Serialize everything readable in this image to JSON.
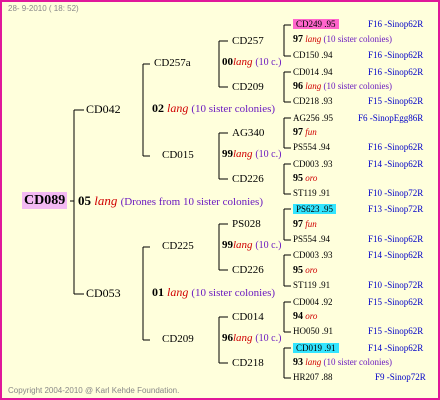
{
  "header": {
    "timestamp": "28- 9-2010 ( 18: 52)"
  },
  "footer": {
    "copyright": "Copyright 2004-2010 @ Karl Kehde Foundation."
  },
  "root": {
    "id": "CD089",
    "gen": "05",
    "lang": "lang",
    "note": "(Drones from 10 sister colonies)"
  },
  "level1": [
    {
      "id": "CD042",
      "gen": "02",
      "lang": "lang",
      "note": "(10 sister colonies)"
    },
    {
      "id": "CD053",
      "gen": "01",
      "lang": "lang",
      "note": "(10 sister colonies)"
    }
  ],
  "level2": [
    {
      "id": "CD257a",
      "gen": "00",
      "lang": "lang",
      "note": "(10 c.)"
    },
    {
      "id": "CD015",
      "gen": "99",
      "lang": "lang",
      "note": "(10 c.)"
    },
    {
      "id": "CD225",
      "gen": "99",
      "lang": "lang",
      "note": "(10 c.)"
    },
    {
      "id": "CD209",
      "gen": "96",
      "lang": "lang",
      "note": "(10 c.)"
    }
  ],
  "level3": [
    {
      "id": "CD257"
    },
    {
      "id": "CD209"
    },
    {
      "id": "AG340"
    },
    {
      "id": "CD226"
    },
    {
      "id": "PS028"
    },
    {
      "id": "CD226"
    },
    {
      "id": "CD014"
    },
    {
      "id": "CD218"
    }
  ],
  "rows": [
    {
      "left": "CD249 .95",
      "right": "F16 -Sinop62R"
    },
    {
      "cnt": "97",
      "lang": "lang",
      "note": "(10 sister colonies)"
    },
    {
      "left": "CD150 .94",
      "right": "F16 -Sinop62R"
    },
    {
      "left": "CD014 .94",
      "right": "F16 -Sinop62R"
    },
    {
      "cnt": "96",
      "lang": "lang",
      "note": "(10 sister colonies)"
    },
    {
      "left": "CD218 .93",
      "right": "F15 -Sinop62R"
    },
    {
      "left": "AG256 .95",
      "right": "F6 -SinopEgg86R"
    },
    {
      "cnt": "97",
      "lang": "fun"
    },
    {
      "left": "PS554 .94",
      "right": "F16 -Sinop62R"
    },
    {
      "left": "CD003 .93",
      "right": "F14 -Sinop62R"
    },
    {
      "cnt": "95",
      "lang": "oro"
    },
    {
      "left": "ST119 .91",
      "right": "F10 -Sinop72R"
    },
    {
      "left": "PS623 .95",
      "right": "F13 -Sinop72R"
    },
    {
      "cnt": "97",
      "lang": "fun"
    },
    {
      "left": "PS554 .94",
      "right": "F16 -Sinop62R"
    },
    {
      "left": "CD003 .93",
      "right": "F14 -Sinop62R"
    },
    {
      "cnt": "95",
      "lang": "oro"
    },
    {
      "left": "ST119 .91",
      "right": "F10 -Sinop72R"
    },
    {
      "left": "CD004 .92",
      "right": "F15 -Sinop62R"
    },
    {
      "cnt": "94",
      "lang": "oro"
    },
    {
      "left": "HO050 .91",
      "right": "F15 -Sinop62R"
    },
    {
      "left": "CD019 .91",
      "right": "F14 -Sinop62R"
    },
    {
      "cnt": "93",
      "lang": "lang",
      "note": "(10 sister colonies)"
    },
    {
      "left": "HR207 .88",
      "right": "F9 -Sinop72R"
    }
  ],
  "colors": {
    "border": "#e0189a",
    "background": "#ffffdc",
    "lang": "#d00000",
    "sisters": "#6a19c0",
    "sinop": "#0000c8",
    "highlight_pink": "#ff66cc",
    "highlight_cyan": "#33e5ff",
    "root_highlight": "#f3b9f3"
  }
}
